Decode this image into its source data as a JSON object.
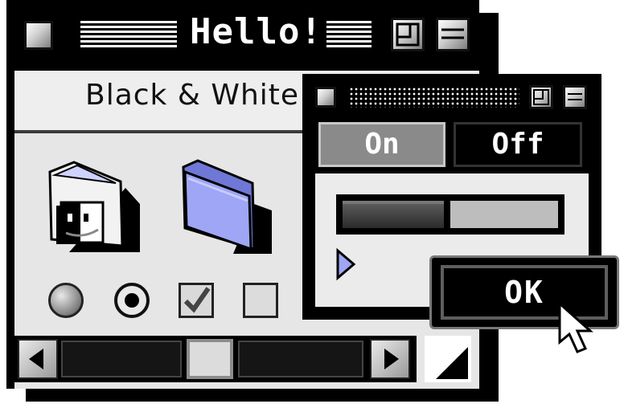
{
  "main_window": {
    "title": "Hello!",
    "header_text": "Black & White"
  },
  "dialog": {
    "toggle": {
      "on_label": "On",
      "off_label": "Off",
      "selected": "On"
    },
    "progress_fraction": 0.5
  },
  "ok_button": {
    "label": "OK"
  },
  "controls": {
    "radio_unselected": false,
    "radio_selected": true,
    "checkbox_checked": true,
    "checkbox_unchecked": false
  },
  "icons": {
    "finder_folder": "finder-folder-icon",
    "folder": "folder-icon",
    "cursor": "arrow-cursor-icon"
  },
  "colors": {
    "folder": "#9ea6f5",
    "folder_dark": "#6f78d6",
    "chrome": "#000000",
    "content": "#e6e6e6"
  }
}
